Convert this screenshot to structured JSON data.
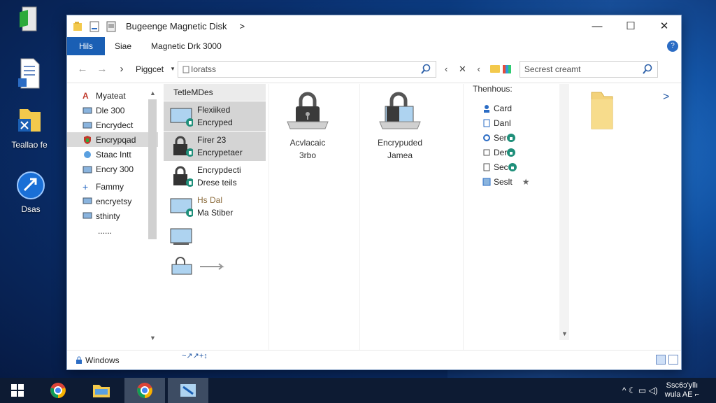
{
  "colors": {
    "accent": "#1a5fb4",
    "selection": "#d4d4d4",
    "folder": "#f3c94c",
    "taskbar": "#0d1b33"
  },
  "desktop": {
    "icons": [
      {
        "label": "",
        "icon": "recycle-bin-icon"
      },
      {
        "label": "",
        "icon": "document-icon"
      },
      {
        "label": "Teallao fe",
        "icon": "folder-shortcut-icon"
      },
      {
        "label": "Dsas",
        "icon": "blue-orb-icon"
      }
    ]
  },
  "window": {
    "title": "Bugeenge Magnetic Disk",
    "title_chevron": ">",
    "controls": {
      "minimize": "—",
      "maximize": "☐",
      "close": "✕"
    },
    "ribbon": {
      "file_tab": "Hils",
      "tabs": [
        "Siae",
        "Magnetic Drk 3000"
      ],
      "help": "?"
    },
    "address": {
      "breadcrumb": "Piggcet",
      "path": "Ioratss",
      "toolbar_symbols": "‹ ✕ ‹",
      "search_placeholder": "Secrest creamt"
    },
    "nav": {
      "items": [
        {
          "label": "Myateat",
          "icon": "a-icon",
          "selected": false
        },
        {
          "label": "Dle 300",
          "icon": "drive-icon",
          "selected": false
        },
        {
          "label": "Encrydect",
          "icon": "drive-icon",
          "selected": false
        },
        {
          "label": "Encrypqad",
          "icon": "shield-icon",
          "selected": true
        },
        {
          "label": "Staac Intt",
          "icon": "network-icon",
          "selected": false
        },
        {
          "label": "Encry 300",
          "icon": "folder-icon",
          "selected": false
        },
        {
          "label": "Fammy",
          "icon": "plus-icon",
          "selected": false
        },
        {
          "label": "encryetsy",
          "icon": "monitor-icon",
          "selected": false
        },
        {
          "label": "sthinty",
          "icon": "monitor-icon",
          "selected": false
        },
        {
          "label": "......",
          "icon": "",
          "selected": false
        }
      ],
      "scroll_up": "▲",
      "scroll_down": "▼"
    },
    "list": {
      "header": "TetleMDes",
      "items": [
        {
          "line1": "Flexiiked",
          "line2": "Encryped",
          "icon": "monitor-icon",
          "selected": true
        },
        {
          "line1": "Firer 23",
          "line2": "Encrypetaer",
          "icon": "lock-icon",
          "selected": true
        },
        {
          "line1": "Encrypdecti",
          "line2": "Drese teils",
          "icon": "lock-icon",
          "selected": false
        },
        {
          "line1": "Hs Dal",
          "line2": "Ma Stiber",
          "icon": "monitor-icon",
          "selected": false
        },
        {
          "line1": "",
          "line2": "",
          "icon": "monitor-icon",
          "selected": false
        },
        {
          "line1": "",
          "line2": "",
          "icon": "lock-small-icon",
          "selected": false
        }
      ],
      "footer_glyphs": "~↗↗+↕"
    },
    "tiles": [
      {
        "line1": "Acvlacaic",
        "line2": "3rbo",
        "icon": "padlock-drive-icon"
      },
      {
        "line1": "Encrypuded",
        "line2": "Jamea",
        "icon": "padlock-monitor-icon"
      }
    ],
    "details": {
      "header": "Thenhous:",
      "items": [
        {
          "label": "Card",
          "icon": "person-icon",
          "lock": false,
          "star": false
        },
        {
          "label": "Danl",
          "icon": "document-icon",
          "lock": false,
          "star": false
        },
        {
          "label": "Ser",
          "icon": "gear-icon",
          "lock": true,
          "star": false
        },
        {
          "label": "Der",
          "icon": "disk-icon",
          "lock": true,
          "star": false
        },
        {
          "label": "Sec",
          "icon": "document-icon",
          "lock": true,
          "star": false
        },
        {
          "label": "Seslt",
          "icon": "grid-icon",
          "lock": false,
          "star": true
        }
      ],
      "star_glyph": "★",
      "lock_glyph": "🔒"
    },
    "right_chevron": ">",
    "status": {
      "text": "Windows"
    }
  },
  "taskbar": {
    "apps": [
      "windows-start-icon",
      "chrome-icon",
      "file-explorer-icon",
      "chrome-icon",
      "app-icon"
    ],
    "tray_symbols": "^ ☾ ▭ ◁)",
    "clock": {
      "line1": "Ssc6ɔ'yllı",
      "line2": "wula AE ⌐"
    }
  }
}
